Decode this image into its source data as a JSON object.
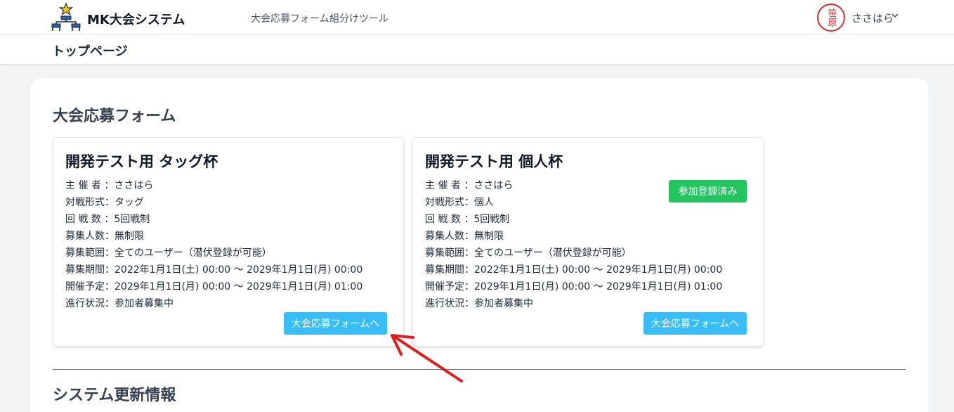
{
  "app": {
    "brand": "MK大会システム"
  },
  "nav": {
    "links": [
      "大会応募フォーム",
      "組分けツール"
    ]
  },
  "user": {
    "name": "ささはら",
    "seal_text": "笹原"
  },
  "page": {
    "title": "トップページ"
  },
  "sections": {
    "forms_title": "大会応募フォーム",
    "updates_title": "システム更新情報"
  },
  "cards": [
    {
      "title": "開発テスト用 タッグ杯",
      "rows": [
        "主 催 者 ：ささはら",
        "対戦形式：タッグ",
        "回 戦 数 ：5回戦制",
        "募集人数：無制限",
        "募集範囲：全てのユーザー（潜伏登録が可能）",
        "募集期間：2022年1月1日(土) 00:00 〜 2029年1月1日(月) 00:00",
        "開催予定：2029年1月1日(月) 00:00 〜 2029年1月1日(月) 01:00",
        "進行状況：参加者募集中"
      ],
      "button": "大会応募フォームへ"
    },
    {
      "title": "開発テスト用 個人杯",
      "rows": [
        "主 催 者 ：ささはら",
        "対戦形式：個人",
        "回 戦 数 ：5回戦制",
        "募集人数：無制限",
        "募集範囲：全てのユーザー（潜伏登録が可能）",
        "募集期間：2022年1月1日(土) 00:00 〜 2029年1月1日(月) 00:00",
        "開催予定：2029年1月1日(月) 00:00 〜 2029年1月1日(月) 01:00",
        "進行状況：参加者募集中"
      ],
      "badge": "参加登録済み",
      "button": "大会応募フォームへ"
    }
  ],
  "colors": {
    "accent_button": "#38bdf8",
    "badge_green": "#22c55e",
    "annotation_arrow": "#e11d1d",
    "seal_red": "#d62c2c"
  },
  "icons": {
    "logo": "tournament-bracket-star-icon",
    "avatar": "hanko-seal-icon",
    "dropdown": "chevron-down-icon",
    "annotation": "red-arrow-icon"
  }
}
